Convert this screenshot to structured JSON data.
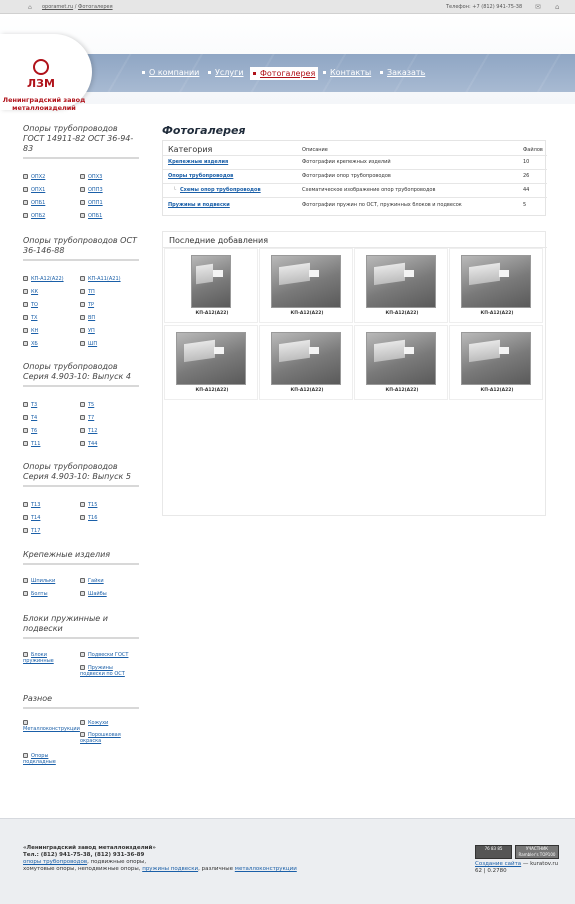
{
  "topbar": {
    "home_icon": "home-icon",
    "site_link": "oporamet.ru",
    "separator": " / ",
    "current": "Фотогалерея",
    "phone": "Телефон: +7 (812) 941-75-38",
    "mail_icon": "mail-icon",
    "sitemap_icon": "sitemap-icon"
  },
  "logo": {
    "mark": "ЛЗМ",
    "name": "Ленинградский завод металлоизделий",
    "brand_color": "#b0121a"
  },
  "nav": [
    {
      "label": "О компании"
    },
    {
      "label": "Услуги"
    },
    {
      "label": "Фотогалерея",
      "active": true
    },
    {
      "label": "Контакты"
    },
    {
      "label": "Заказать"
    }
  ],
  "sidebar": {
    "s1": {
      "title": "Опоры трубопроводов ГОСТ 14911-82 ОСТ 36-94-83",
      "items": [
        "ОПХ2",
        "ОПХ3",
        "ОПХ1",
        "ОПП3",
        "ОПБ1",
        "ОПП1",
        "ОПБ2",
        "ОПБ1"
      ]
    },
    "s2": {
      "title": "Опоры трубопроводов ОСТ 36-146-88",
      "items": [
        "КП-А12(А22)",
        "КП-А11(А21)",
        "КК",
        "ТП",
        "ТО",
        "ТР",
        "ТХ",
        "ВП",
        "КН",
        "УП",
        "ХБ",
        "ШП"
      ]
    },
    "s3": {
      "title": "Опоры трубопроводов Серия 4.903-10: Выпуск 4",
      "items": [
        "Т3",
        "Т5",
        "Т4",
        "Т7",
        "Т6",
        "Т12",
        "Т11",
        "Т44"
      ]
    },
    "s4": {
      "title": "Опоры трубопроводов Серия 4.903-10: Выпуск 5",
      "items": [
        "Т13",
        "Т15",
        "Т14",
        "Т16",
        "Т17"
      ]
    },
    "s5": {
      "title": "Крепежные изделия",
      "items": [
        "Шпильки",
        "Гайки",
        "Болты",
        "Шайбы"
      ]
    },
    "s6": {
      "title": "Блоки пружинные и подвески",
      "items": [
        "Блоки пружинные",
        "Подвески ГОСТ",
        "Пружины подвески по ОСТ"
      ]
    },
    "s7": {
      "title": "Разное",
      "items": [
        "Металлоконструкции",
        "Кожухи",
        "Порошковая окраска",
        "Опоры подкладные"
      ]
    }
  },
  "main": {
    "title": "Фотогалерея",
    "table": {
      "headers": [
        "Категория",
        "Описание",
        "Файлов"
      ],
      "rows": [
        [
          "Крепежные изделия",
          "Фотографии крепежных изделий",
          "10"
        ],
        [
          "Опоры трубопроводов",
          "Фотографии опор трубопроводов",
          "26"
        ],
        [
          "Схемы опор трубопроводов",
          "Схематическое изображение опор трубопроводов",
          "44"
        ],
        [
          "Пружины и подвески",
          "Фотографии пружин по ОСТ, пружинных блоков и подвесок",
          "5"
        ]
      ]
    },
    "recent_title": "Последние добавления",
    "photos": [
      "КП-А12(А22)",
      "КП-А12(А22)",
      "КП-А12(А22)",
      "КП-А12(А22)",
      "КП-А12(А22)",
      "КП-А12(А22)",
      "КП-А12(А22)",
      "КП-А12(А22)"
    ]
  },
  "footer": {
    "company": "«Ленинградский завод металлоизделий»",
    "tel": "Тел.: (812) 941-75-38, (812) 931-36-89",
    "line3_link": "опоры трубопроводов",
    "line3_rest": ", подвижные опоры,",
    "line4_pre": "хомутовые опоры, неподвижные опоры, ",
    "line4_link1": "пружины подвески",
    "line4_mid": ", различные ",
    "line4_link2": "металлоконструкции",
    "counter1": "76 83 85",
    "counter2": "УЧАСТНИК Rambler's TOP100",
    "credit_link": "Создание сайта",
    "credit_rest": " — kuratov.ru",
    "stats": "62 | 0.2780"
  }
}
